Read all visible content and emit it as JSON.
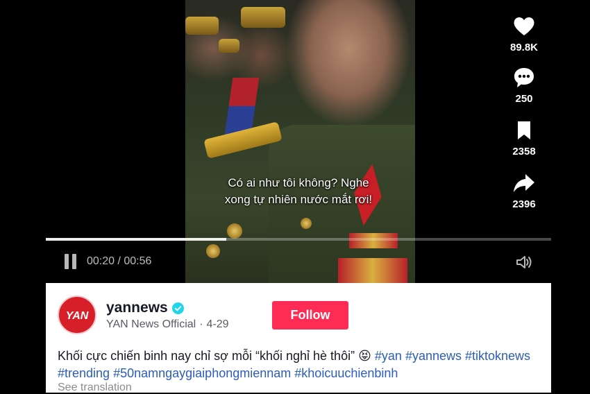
{
  "video": {
    "caption_line1": "Có ai như tôi không? Nghe",
    "caption_line2": "xong tự nhiên nước mắt rơi!",
    "time_display": "00:20 / 00:56",
    "progress_fraction": 0.357
  },
  "actions": {
    "likes": "89.8K",
    "comments": "250",
    "saves": "2358",
    "shares": "2396"
  },
  "post": {
    "avatar_text": "YAN",
    "username": "yannews",
    "display_name": "YAN News Official",
    "date": "4-29",
    "follow_label": "Follow",
    "description_text": "Khối cực chiến binh nay chỉ sợ mỗi “khối nghỉ hè thôi”",
    "emoji": "😝",
    "hashtags": [
      "#yan",
      "#yannews",
      "#tiktoknews",
      "#trending",
      "#50namngaygiaiphongmiennam",
      "#khoicuuchienbinh"
    ],
    "see_translation": "See translation"
  },
  "colors": {
    "follow_button": "#fe2c55",
    "hashtag": "#2b5db9",
    "verified_badge": "#20d5ec",
    "avatar_bg": "#d71f2a"
  },
  "icons": [
    "pause-icon",
    "volume-icon",
    "heart-icon",
    "comment-icon",
    "bookmark-icon",
    "share-icon",
    "verified-icon"
  ]
}
